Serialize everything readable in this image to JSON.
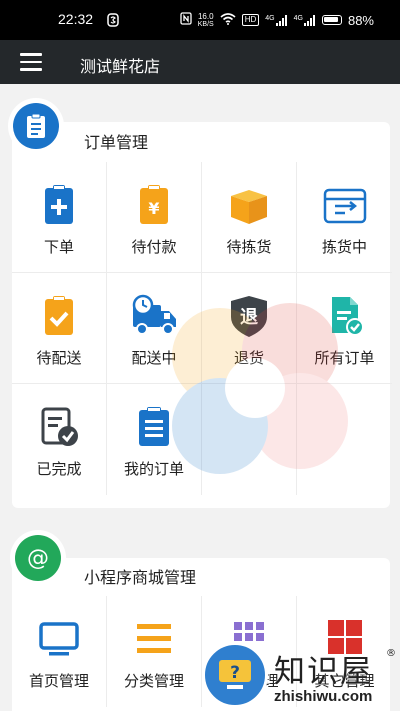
{
  "status_bar": {
    "time": "22:32",
    "speed_value": "16.0",
    "speed_unit": "KB/S",
    "hd_label": "HD",
    "net1": "4G",
    "net2": "4G",
    "battery": "88%"
  },
  "nav": {
    "title": "测试鲜花店"
  },
  "orders": {
    "title": "订单管理",
    "items": [
      {
        "label": "下单",
        "icon": "clipboard-plus-icon"
      },
      {
        "label": "待付款",
        "icon": "clipboard-yen-icon"
      },
      {
        "label": "待拣货",
        "icon": "box-icon"
      },
      {
        "label": "拣货中",
        "icon": "package-arrow-icon"
      },
      {
        "label": "待配送",
        "icon": "clipboard-check-icon"
      },
      {
        "label": "配送中",
        "icon": "delivery-truck-icon"
      },
      {
        "label": "退货",
        "icon": "return-shield-icon",
        "glyph": "退"
      },
      {
        "label": "所有订单",
        "icon": "document-check-icon"
      },
      {
        "label": "已完成",
        "icon": "completed-doc-icon"
      },
      {
        "label": "我的订单",
        "icon": "clipboard-list-icon"
      }
    ]
  },
  "mall": {
    "title": "小程序商城管理",
    "items": [
      {
        "label": "首页管理",
        "icon": "monitor-icon"
      },
      {
        "label": "分类管理",
        "icon": "menu-bars-icon"
      },
      {
        "label": "理",
        "icon": "grid-icon"
      },
      {
        "label": "其它管理",
        "icon": "red-grid-icon"
      }
    ]
  },
  "watermark_brand": {
    "cn": "知识屋",
    "en": "zhishiwu.com",
    "reg": "®"
  },
  "colors": {
    "blue": "#1a73c8",
    "orange": "#f5a31a",
    "teal": "#1fb5a8",
    "dark": "#3d4349",
    "green": "#22a85a",
    "navbar": "#24282b"
  }
}
